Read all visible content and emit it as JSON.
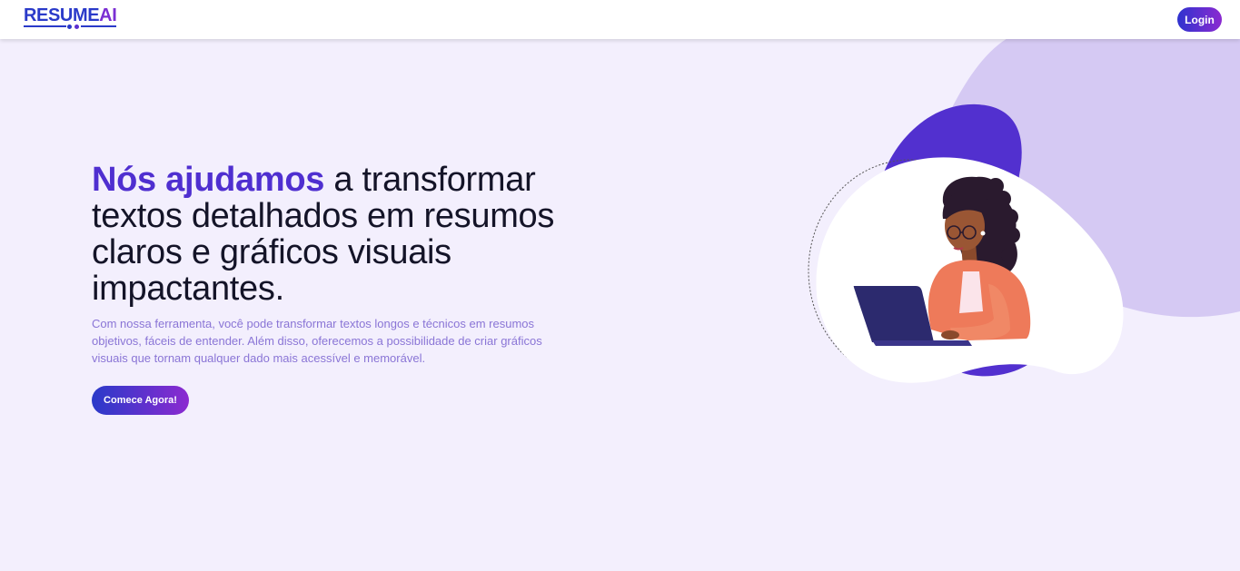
{
  "navbar": {
    "logo_main": "RESUME",
    "logo_accent": "AI",
    "login_label": "Login"
  },
  "hero": {
    "headline_accent": "Nós ajudamos",
    "headline_rest": " a transformar textos detalhados em resumos claros e gráficos visuais impactantes.",
    "subtext": "Com nossa ferramenta, você pode transformar textos longos e técnicos em resumos objetivos, fáceis de entender. Além disso, oferecemos a possibilidade de criar gráficos visuais que tornam qualquer dado mais acessível e memorável.",
    "cta_label": "Comece Agora!"
  },
  "colors": {
    "brand_blue": "#2a3ac9",
    "brand_purple": "#8b2ad0",
    "accent": "#4f2fd0",
    "background": "#f3effd",
    "blob_light": "#d5c9f3",
    "blob_dark": "#5230cf"
  },
  "icons": [
    "logo-dots-icon"
  ]
}
